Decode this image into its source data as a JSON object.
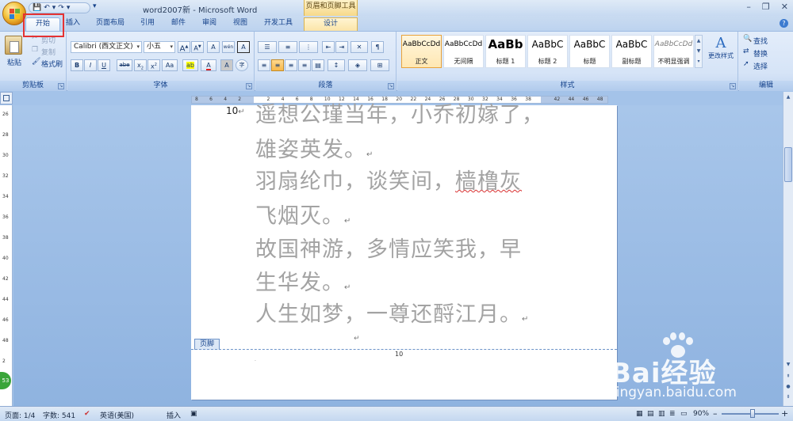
{
  "window": {
    "title": "word2007新 - Microsoft Word",
    "context_group": "页眉和页脚工具",
    "controls": [
      "–",
      "❐",
      "✕"
    ]
  },
  "quick_access": {
    "save_glyph": "💾",
    "undo_glyph": "↶",
    "undo_dd": "▾",
    "redo_glyph": "↷",
    "redo_dd": "▾",
    "customize_glyph": "▾"
  },
  "tabs": [
    {
      "label": "开始"
    },
    {
      "label": "插入"
    },
    {
      "label": "页面布局"
    },
    {
      "label": "引用"
    },
    {
      "label": "邮件"
    },
    {
      "label": "审阅"
    },
    {
      "label": "视图"
    },
    {
      "label": "开发工具"
    },
    {
      "label": "设计"
    }
  ],
  "clipboard": {
    "paste": "粘贴",
    "cut": "剪切",
    "copy": "复制",
    "format_painter": "格式刷",
    "group": "剪贴板"
  },
  "font": {
    "family": "Calibri (西文正文)",
    "size": "小五",
    "grow": "A",
    "shrink": "A",
    "clear": "A",
    "pinyin": "wén",
    "border_char": "A",
    "bold": "B",
    "italic": "I",
    "underline": "U",
    "strike": "abe",
    "subscript": "x",
    "superscript": "x",
    "case": "Aa",
    "highlight": "ab",
    "color": "A",
    "shading": "A",
    "circle": "字",
    "group": "字体"
  },
  "paragraph": {
    "group": "段落"
  },
  "styles": {
    "items": [
      {
        "sample": "AaBbCcDd",
        "name": "正文",
        "selected": true
      },
      {
        "sample": "AaBbCcDd",
        "name": "无间隔",
        "selected": false
      },
      {
        "sample": "AaBb",
        "name": "标题 1",
        "selected": false
      },
      {
        "sample": "AaBbC",
        "name": "标题 2",
        "selected": false
      },
      {
        "sample": "AaBbC",
        "name": "标题",
        "selected": false
      },
      {
        "sample": "AaBbC",
        "name": "副标题",
        "selected": false
      },
      {
        "sample": "AaBbCcDd",
        "name": "不明显强调",
        "selected": false
      }
    ],
    "change": "更改样式",
    "group": "样式"
  },
  "editing": {
    "find": "查找",
    "replace": "替换",
    "select": "选择",
    "group": "编辑"
  },
  "document": {
    "line_number": "10",
    "lines": [
      "遥想公瑾当年，小乔初嫁了，",
      "雄姿英发。",
      "羽扇纶巾，谈笑间，樯橹灰",
      "飞烟灭。",
      "故国神游，多情应笑我，早",
      "生华发。",
      "人生如梦，一尊还酹江月。"
    ],
    "footer_tag": "页脚",
    "footer_page_number": "10",
    "pilcrow": "↵"
  },
  "hruler_ticks": [
    "8",
    "6",
    "4",
    "2",
    "",
    "2",
    "4",
    "6",
    "8",
    "10",
    "12",
    "14",
    "16",
    "18",
    "20",
    "22",
    "24",
    "26",
    "28",
    "30",
    "32",
    "34",
    "36",
    "38",
    "",
    "42",
    "44",
    "46",
    "48"
  ],
  "vruler_ticks": [
    "26",
    "28",
    "30",
    "32",
    "34",
    "36",
    "38",
    "40",
    "42",
    "44",
    "46",
    "48",
    "2",
    "4"
  ],
  "side_badge": "53",
  "status": {
    "page": "页面: 1/4",
    "words": "字数: 541",
    "language": "英语(美国)",
    "mode": "插入",
    "zoom": "90%",
    "zoom_minus": "–",
    "zoom_plus": "+"
  },
  "watermark": {
    "brand": "Bai经验",
    "url": "jingyan.baidu.com"
  },
  "colors": {
    "accent": "#15428b",
    "highlight_box": "#e53232",
    "context_tab": "#fbe5a8",
    "doc_text": "#a3a3a3"
  }
}
